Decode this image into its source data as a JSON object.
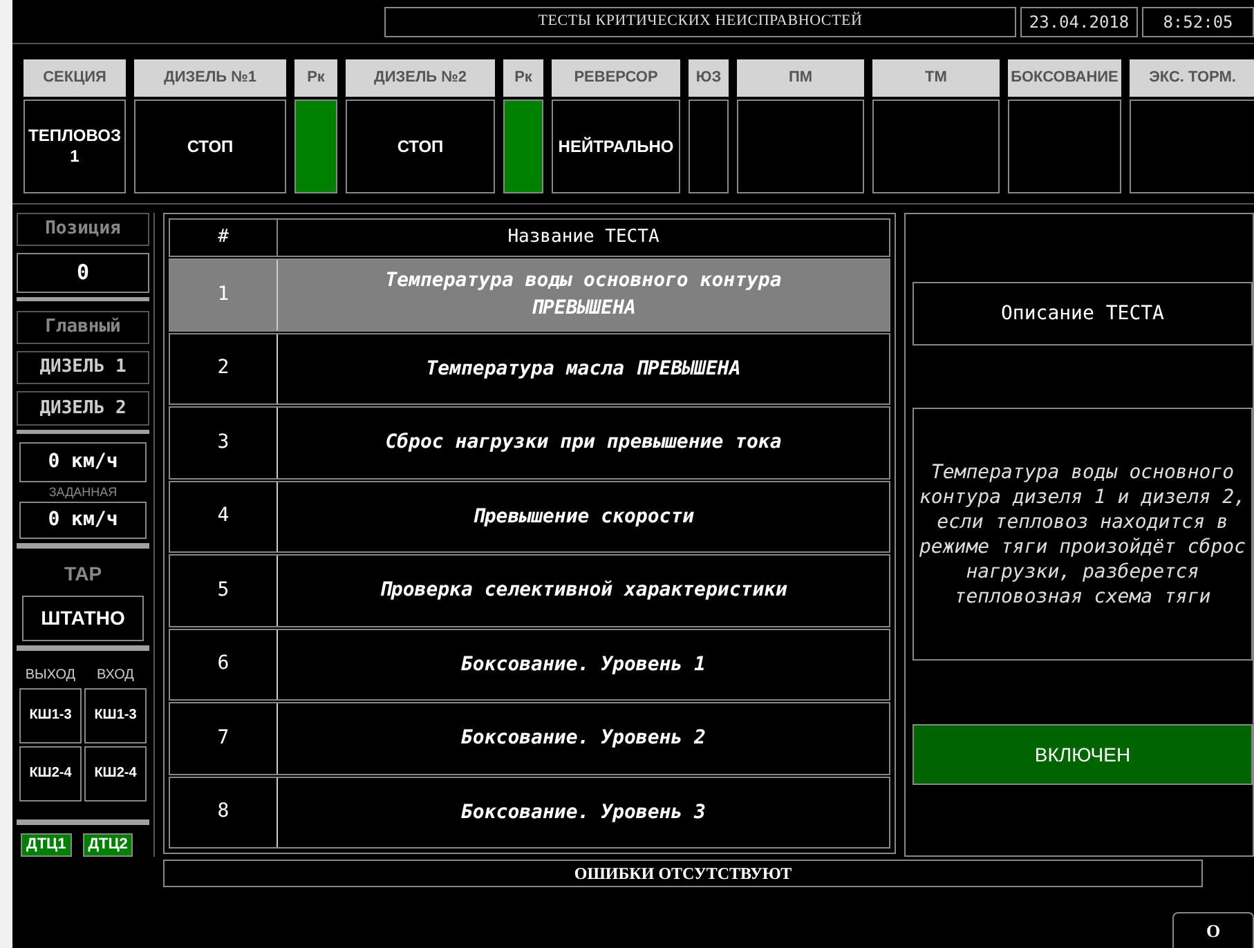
{
  "title": "ТЕСТЫ КРИТИЧЕСКИХ НЕИСПРАВНОСТЕЙ",
  "date": "23.04.2018",
  "time": "8:52:05",
  "status_columns": [
    {
      "header": "СЕКЦИЯ",
      "kind": "text",
      "value": "ТЕПЛОВОЗ 1"
    },
    {
      "header": "ДИЗЕЛЬ №1",
      "kind": "text",
      "value": "СТОП"
    },
    {
      "header": "Рк",
      "kind": "indicator",
      "on": true
    },
    {
      "header": "ДИЗЕЛЬ №2",
      "kind": "text",
      "value": "СТОП"
    },
    {
      "header": "Рк",
      "kind": "indicator",
      "on": true
    },
    {
      "header": "РЕВЕРСОР",
      "kind": "text",
      "value": "НЕЙТРАЛЬНО"
    },
    {
      "header": "ЮЗ",
      "kind": "indicator",
      "on": false
    },
    {
      "header": "ПМ",
      "kind": "indicator",
      "on": false
    },
    {
      "header": "ТМ",
      "kind": "indicator",
      "on": false
    },
    {
      "header": "БОКСОВАНИЕ",
      "kind": "indicator",
      "on": false
    },
    {
      "header": "ЭКС. ТОРМ.",
      "kind": "indicator",
      "on": false
    }
  ],
  "left_panel": {
    "position_label": "Позиция",
    "position_value": "0",
    "main_label": "Главный",
    "diesels": [
      "ДИЗЕЛЬ 1",
      "ДИЗЕЛЬ 2"
    ],
    "speed": "0 км/ч",
    "set_label": "ЗАДАННАЯ",
    "set_speed": "0 км/ч",
    "tar_label": "ТАР",
    "tar_value": "ШТАТНО",
    "io_columns": [
      {
        "label": "ВЫХОД",
        "items": [
          "КШ1-3",
          "КШ2-4"
        ]
      },
      {
        "label": "ВХОД",
        "items": [
          "КШ1-3",
          "КШ2-4"
        ]
      }
    ],
    "dtc": [
      {
        "label": "ДТЦ1",
        "on": true
      },
      {
        "label": "ДТЦ2",
        "on": true
      }
    ]
  },
  "tests": {
    "columns": [
      "#",
      "Название ТЕСТА"
    ],
    "rows": [
      {
        "number": "1",
        "name": "Температура воды основного контура ПРЕВЫШЕНА",
        "selected": true
      },
      {
        "number": "2",
        "name": "Температура масла ПРЕВЫШЕНА",
        "selected": false
      },
      {
        "number": "3",
        "name": "Сброс нагрузки при превышение тока",
        "selected": false
      },
      {
        "number": "4",
        "name": "Превышение скорости",
        "selected": false
      },
      {
        "number": "5",
        "name": "Проверка селективной характеристики",
        "selected": false
      },
      {
        "number": "6",
        "name": "Боксование. Уровень 1",
        "selected": false
      },
      {
        "number": "7",
        "name": "Боксование. Уровень 2",
        "selected": false
      },
      {
        "number": "8",
        "name": "Боксование. Уровень 3",
        "selected": false
      }
    ]
  },
  "description": {
    "title": "Описание ТЕСТА",
    "text": "Температура воды основного контура дизеля 1 и дизеля 2, если тепловоз находится в режиме тяги произойдёт сброс нагрузки, разберется тепловозная схема тяги",
    "button": {
      "label": "ВКЛЮЧЕН",
      "on": true
    }
  },
  "errors": "ОШИБКИ ОТСУТСТВУЮТ",
  "bottom_button": "О"
}
